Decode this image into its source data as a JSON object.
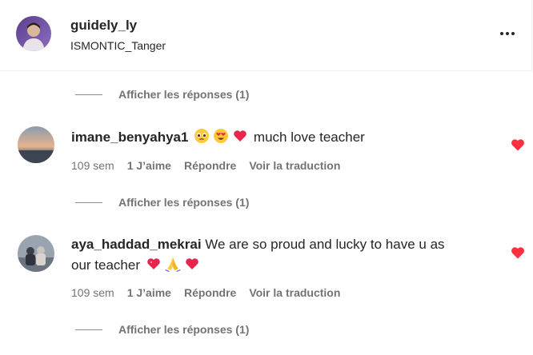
{
  "post": {
    "username": "guidely_ly",
    "location": "ISMONTIC_Tanger",
    "more_icon": "more-horizontal-icon"
  },
  "view_replies_label": "Afficher les réponses (1)",
  "comments": [
    {
      "author": "imane_benyahya1",
      "text_before": "",
      "text": " much love teacher",
      "emojis": [
        "pleading-face-emoji",
        "heart-eyes-emoji",
        "red-heart-emoji"
      ],
      "time": "109 sem",
      "likes": "1 J’aime",
      "reply": "Répondre",
      "translate": "Voir la traduction",
      "liked": true
    },
    {
      "author": "aya_haddad_mekrai",
      "text_line1": " We are so proud and lucky to have u as",
      "text_line2": "our teacher ",
      "emojis": [
        "pink-heart-emoji",
        "folded-hands-emoji",
        "red-heart-emoji"
      ],
      "time": "109 sem",
      "likes": "1 J’aime",
      "reply": "Répondre",
      "translate": "Voir la traduction",
      "liked": true
    }
  ],
  "colors": {
    "like_red": "#ff3040",
    "secondary_text": "#737373",
    "primary_text": "#262626"
  }
}
